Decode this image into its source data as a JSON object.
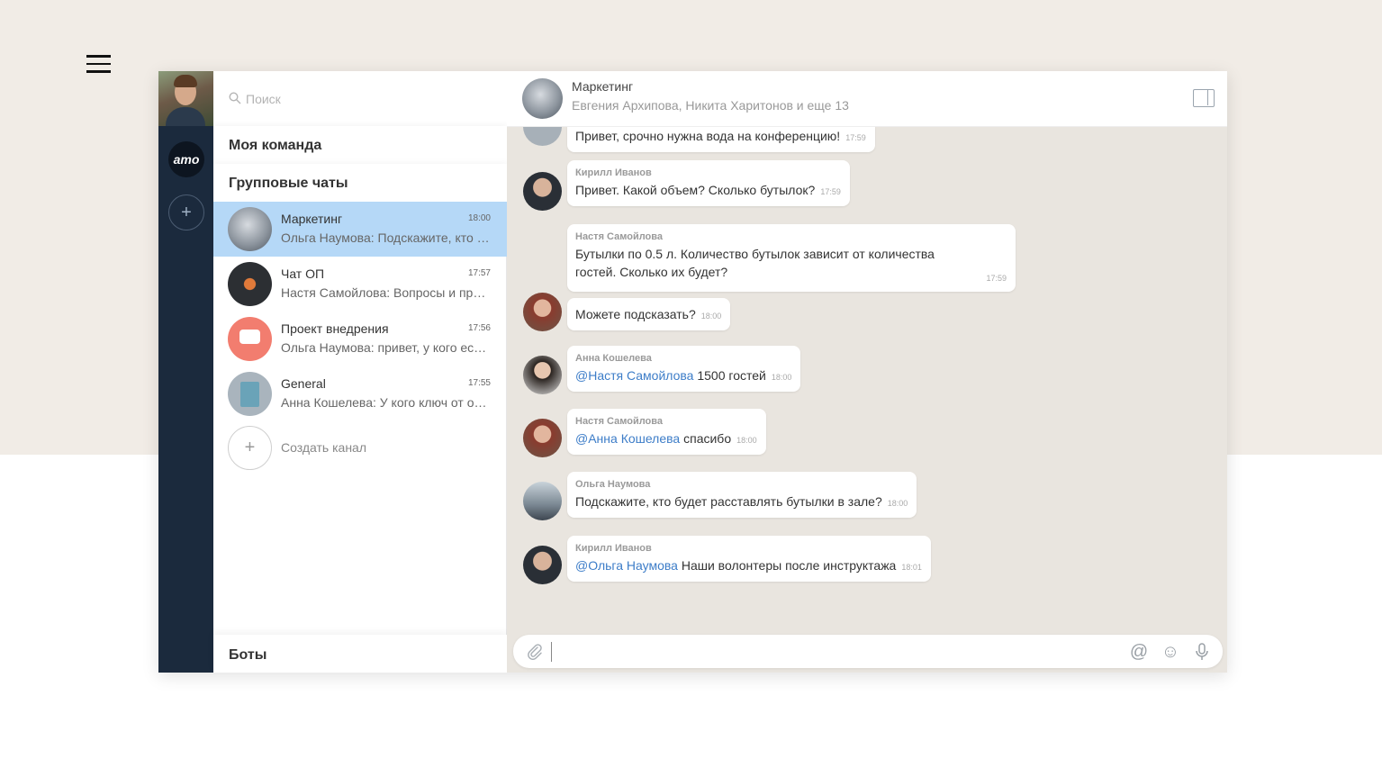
{
  "sidebar": {
    "logo_text": "amo",
    "add_label": "+"
  },
  "list": {
    "search_placeholder": "Поиск",
    "team_section": "Моя команда",
    "groups_section": "Групповые чаты",
    "chats": [
      {
        "name": "Маркетинг",
        "time": "18:00",
        "preview": "Ольга Наумова: Подскажите, кто будет расставлять бутылки в зале?",
        "active": true
      },
      {
        "name": "Чат ОП",
        "time": "17:57",
        "preview": "Настя Самойлова: Вопросы и предложения",
        "active": false
      },
      {
        "name": "Проект внедрения",
        "time": "17:56",
        "preview": "Ольга Наумова: привет, у кого есть ключ",
        "active": false
      },
      {
        "name": "General",
        "time": "17:55",
        "preview": "Анна Кошелева: У кого ключ от офиса?",
        "active": false
      }
    ],
    "create_channel": "Создать канал",
    "bots_section": "Боты"
  },
  "chat": {
    "title": "Маркетинг",
    "subtitle": "Евгения Архипова, Никита Харитонов и еще 13",
    "messages": [
      {
        "sender": "",
        "text": "Привет, срочно нужна вода на конференцию!",
        "time": "17:59"
      },
      {
        "sender": "Кирилл Иванов",
        "text": "Привет. Какой объем? Сколько бутылок?",
        "time": "17:59"
      },
      {
        "sender": "Настя Самойлова",
        "text": "Бутылки по 0.5 л. Количество бутылок зависит от количества гостей. Сколько их будет?",
        "time": "17:59"
      },
      {
        "sender": "",
        "text": "Можете подсказать?",
        "time": "18:00"
      },
      {
        "sender": "Анна Кошелева",
        "mention": "@Настя Самойлова",
        "text": "1500 гостей",
        "time": "18:00"
      },
      {
        "sender": "Настя Самойлова",
        "mention": "@Анна Кошелева",
        "text": "спасибо",
        "time": "18:00"
      },
      {
        "sender": "Ольга Наумова",
        "text": "Подскажите, кто будет расставлять бутылки в зале?",
        "time": "18:00"
      },
      {
        "sender": "Кирилл Иванов",
        "mention": "@Ольга Наумова",
        "text": "Наши волонтеры после инструктажа",
        "time": "18:01"
      }
    ]
  },
  "composer": {
    "at_icon": "@",
    "emoji_icon": "☺",
    "mic_icon": "mic-icon"
  },
  "colors": {
    "rail": "#1b2a3d",
    "active_chat": "#b5d8f7",
    "mention": "#3d7dc8",
    "chat_bg": "#e9e5df",
    "page_bg_top": "#f1ece6"
  }
}
